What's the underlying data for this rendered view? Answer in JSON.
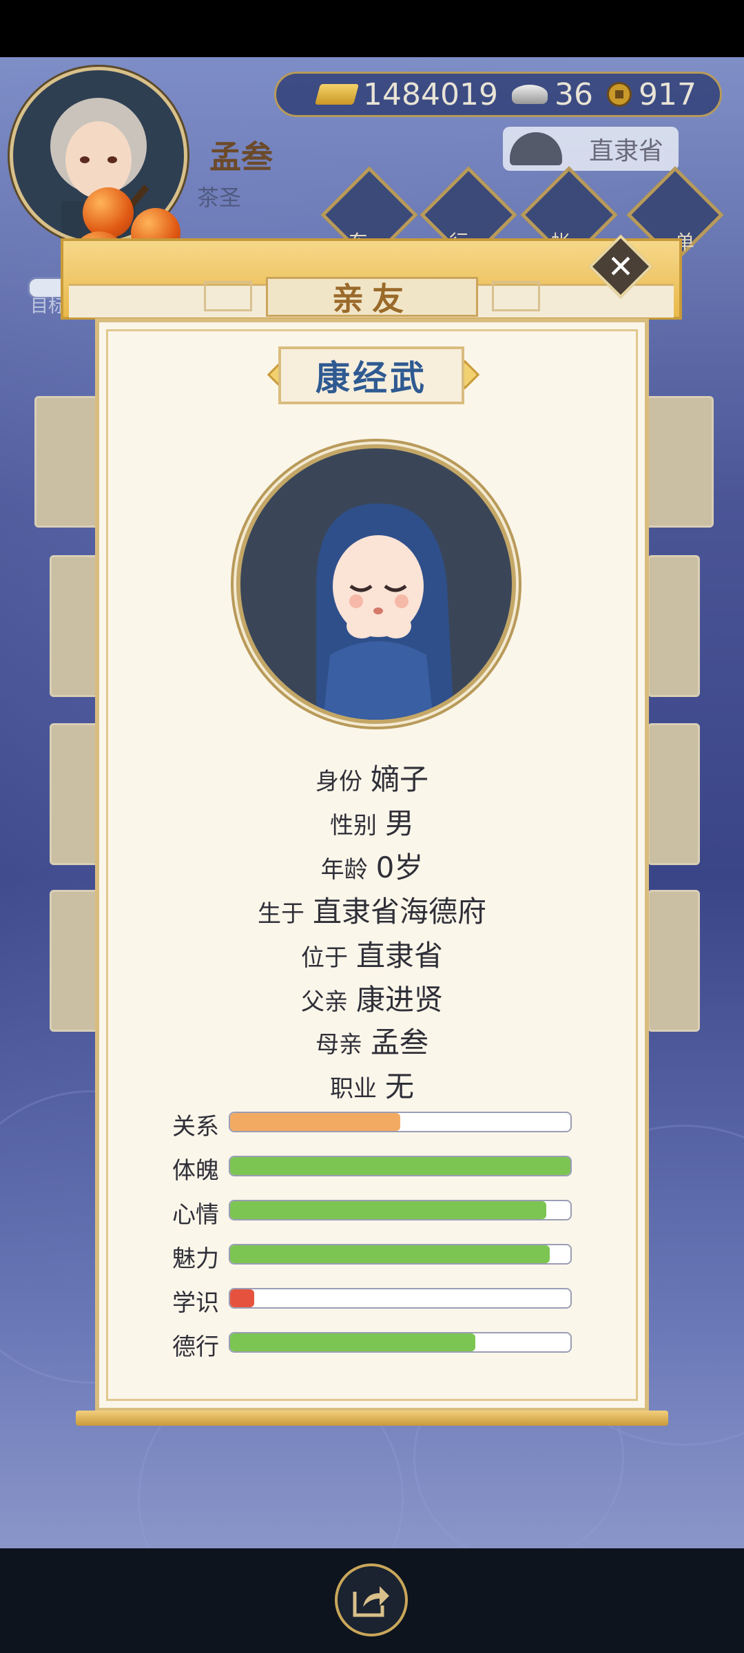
{
  "player": {
    "name": "孟叁",
    "title": "茶圣"
  },
  "resources": {
    "gold": "1484019",
    "silver": "36",
    "coins": "917"
  },
  "location": "直隶省",
  "top_menu": [
    {
      "label": "东",
      "icon": "house-icon"
    },
    {
      "label": "行",
      "icon": "gift-icon"
    },
    {
      "label": "帐",
      "icon": "ledger-icon"
    },
    {
      "label": "单",
      "icon": "more-icon"
    }
  ],
  "target_label": "目标",
  "modal": {
    "title": "亲友",
    "person_name": "康经武",
    "info": [
      {
        "label": "身份",
        "value": "嫡子"
      },
      {
        "label": "性别",
        "value": "男"
      },
      {
        "label": "年龄",
        "value": "0岁"
      },
      {
        "label": "生于",
        "value": "直隶省海德府"
      },
      {
        "label": "位于",
        "value": "直隶省"
      },
      {
        "label": "父亲",
        "value": "康进贤"
      },
      {
        "label": "母亲",
        "value": "孟叁"
      },
      {
        "label": "职业",
        "value": "无"
      }
    ],
    "stats": [
      {
        "label": "关系",
        "fraction": 0.5,
        "color": "#f2aa62"
      },
      {
        "label": "体魄",
        "fraction": 1.0,
        "color": "#7cc552"
      },
      {
        "label": "心情",
        "fraction": 0.93,
        "color": "#7cc552"
      },
      {
        "label": "魅力",
        "fraction": 0.94,
        "color": "#7cc552"
      },
      {
        "label": "学识",
        "fraction": 0.07,
        "color": "#e5533f"
      },
      {
        "label": "德行",
        "fraction": 0.72,
        "color": "#7cc552"
      }
    ]
  }
}
